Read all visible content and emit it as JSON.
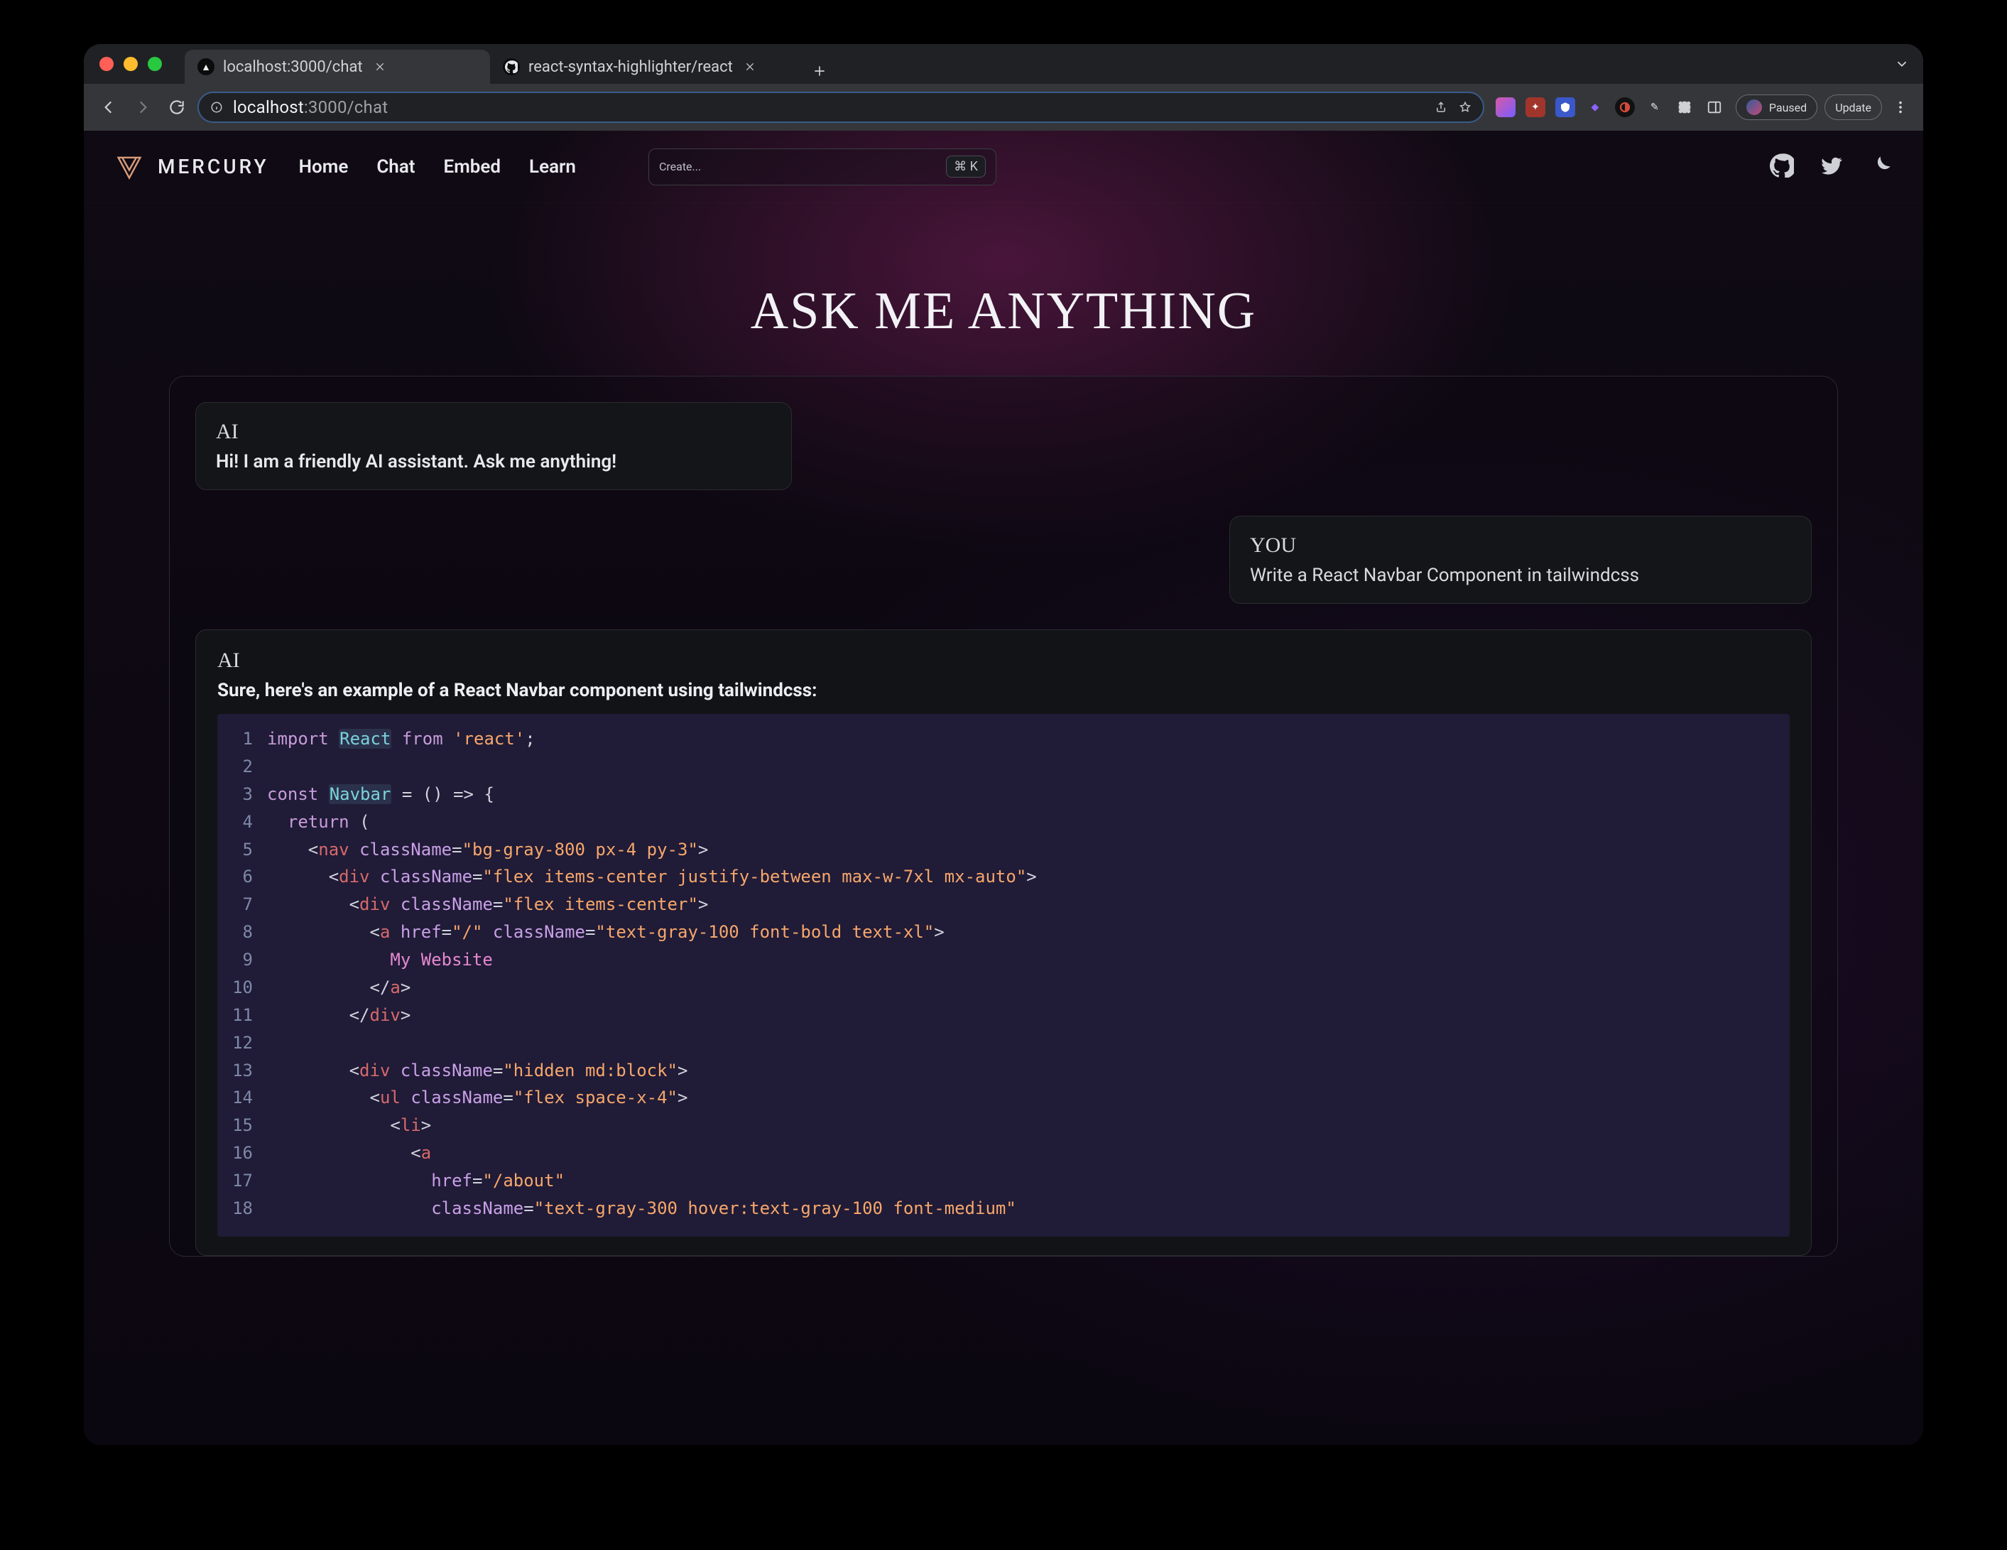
{
  "browser": {
    "tabs": [
      {
        "title": "localhost:3000/chat",
        "active": true,
        "favicon": "triangle"
      },
      {
        "title": "react-syntax-highlighter/react",
        "active": false,
        "favicon": "github"
      }
    ],
    "url_host": "localhost",
    "url_path": ":3000/chat",
    "paused": "Paused",
    "update": "Update"
  },
  "header": {
    "brand": "MERCURY",
    "nav": [
      "Home",
      "Chat",
      "Embed",
      "Learn"
    ],
    "search_placeholder": "Create...",
    "kbd": "⌘ K"
  },
  "page": {
    "headline": "ASK ME ANYTHING",
    "msg_ai_label": "AI",
    "msg_ai_text": "Hi! I am a friendly AI assistant. Ask me anything!",
    "msg_user_label": "YOU",
    "msg_user_text": "Write a React Navbar Component in tailwindcss",
    "msg_ai2_label": "AI",
    "msg_ai2_lead": "Sure, here's an example of a React Navbar component using tailwindcss:"
  },
  "code": {
    "t": {
      "import": "import",
      "React": "React",
      "from": "from",
      "react": "'react'",
      "const": "const",
      "Navbar": "Navbar",
      "return": "return",
      "nav": "nav",
      "div": "div",
      "a": "a",
      "ul": "ul",
      "li": "li",
      "className": "className",
      "href": "href",
      "s_nav": "\"bg-gray-800 px-4 py-3\"",
      "s_row": "\"flex items-center justify-between max-w-7xl mx-auto\"",
      "s_left": "\"flex items-center\"",
      "s_href_root": "\"/\"",
      "s_brand": "\"text-gray-100 font-bold text-xl\"",
      "txt_brand": "My Website",
      "s_right": "\"hidden md:block\"",
      "s_ul": "\"flex space-x-4\"",
      "s_href_about": "\"/about\"",
      "s_link": "\"text-gray-300 hover:text-gray-100 font-medium\""
    }
  }
}
